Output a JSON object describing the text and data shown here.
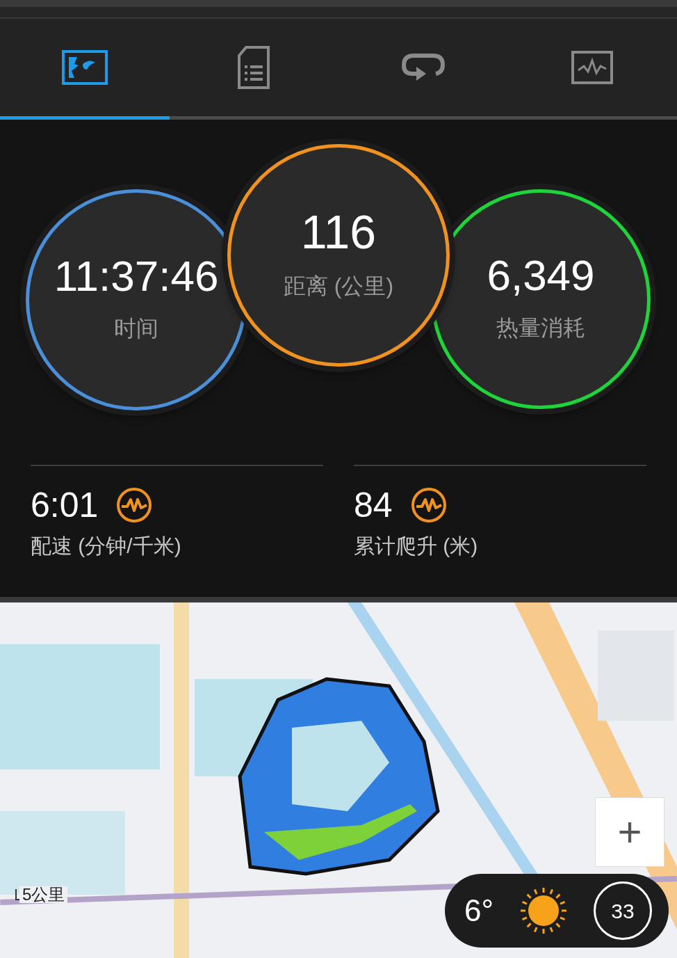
{
  "tabs": [
    {
      "kind": "map",
      "selected": true
    },
    {
      "kind": "document",
      "selected": false
    },
    {
      "kind": "laps",
      "selected": false
    },
    {
      "kind": "chart",
      "selected": false
    }
  ],
  "rings": [
    {
      "value": "11:37:46",
      "label": "时间",
      "color": "#4a8fd8"
    },
    {
      "value": "116",
      "label": "距离 (公里)",
      "color": "#f0921f"
    },
    {
      "value": "6,349",
      "label": "热量消耗",
      "color": "#1fd33a"
    }
  ],
  "metrics": [
    {
      "value": "6:01",
      "label": "配速 (分钟/千米)"
    },
    {
      "value": "84",
      "label": "累计爬升 (米)"
    }
  ],
  "map": {
    "zoom_in": "+",
    "scale": "5公里",
    "weather": {
      "temperature": "6°",
      "index": "33"
    }
  }
}
